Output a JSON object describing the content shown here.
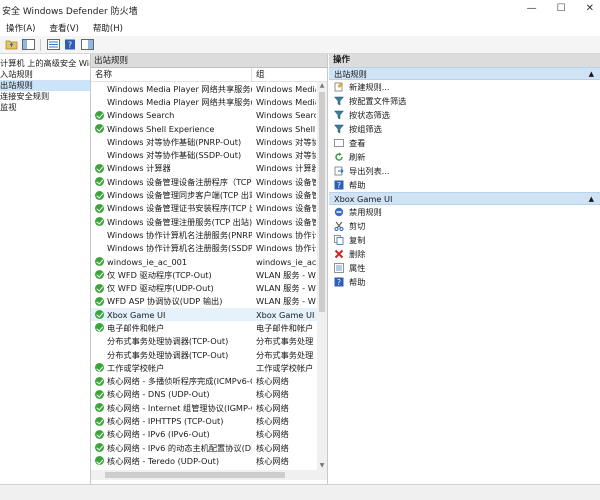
{
  "window": {
    "title": "安全 Windows Defender 防火墙"
  },
  "menu": {
    "items": [
      "操作(A)",
      "查看(V)",
      "帮助(H)"
    ]
  },
  "tree": {
    "items": [
      {
        "label": "计算机 上的高级安全 Windo",
        "selected": false
      },
      {
        "label": "入站规则",
        "selected": false
      },
      {
        "label": "出站规则",
        "selected": true
      },
      {
        "label": "连接安全规则",
        "selected": false
      },
      {
        "label": "监视",
        "selected": false
      }
    ]
  },
  "rules": {
    "pane_title": "出站规则",
    "columns": {
      "name": "名称",
      "group": "组"
    },
    "rows": [
      {
        "name": "Windows Media Player 网络共享服务(U...",
        "group": "Windows Media P",
        "enabled": false,
        "selected": false
      },
      {
        "name": "Windows Media Player 网络共享服务(U...",
        "group": "Windows Media P",
        "enabled": false,
        "selected": false
      },
      {
        "name": "Windows Search",
        "group": "Windows Search",
        "enabled": true,
        "selected": false
      },
      {
        "name": "Windows Shell Experience",
        "group": "Windows Shell Ex",
        "enabled": true,
        "selected": false
      },
      {
        "name": "Windows 对等协作基础(PNRP-Out)",
        "group": "Windows 对等协作",
        "enabled": false,
        "selected": false
      },
      {
        "name": "Windows 对等协作基础(SSDP-Out)",
        "group": "Windows 对等协作",
        "enabled": false,
        "selected": false
      },
      {
        "name": "Windows 计算器",
        "group": "Windows 计算器",
        "enabled": true,
        "selected": false
      },
      {
        "name": "Windows 设备管理设备注册程序（TCP ...",
        "group": "Windows 设备管",
        "enabled": true,
        "selected": false
      },
      {
        "name": "Windows 设备管理同步客户端(TCP 出站)",
        "group": "Windows 设备管",
        "enabled": true,
        "selected": false
      },
      {
        "name": "Windows 设备管理证书安装程序(TCP 出...",
        "group": "Windows 设备管",
        "enabled": true,
        "selected": false
      },
      {
        "name": "Windows 设备管理注册服务(TCP 出站)",
        "group": "Windows 设备管",
        "enabled": true,
        "selected": false
      },
      {
        "name": "Windows 协作计算机名注册服务(PNRP-...",
        "group": "Windows 协作计",
        "enabled": false,
        "selected": false
      },
      {
        "name": "Windows 协作计算机名注册服务(SSDP-...",
        "group": "Windows 协作计",
        "enabled": false,
        "selected": false
      },
      {
        "name": "windows_ie_ac_001",
        "group": "windows_ie_ac_0",
        "enabled": true,
        "selected": false
      },
      {
        "name": "仅 WFD 驱动程序(TCP-Out)",
        "group": "WLAN 服务 - WF",
        "enabled": true,
        "selected": false
      },
      {
        "name": "仅 WFD 驱动程序(UDP-Out)",
        "group": "WLAN 服务 - WF",
        "enabled": true,
        "selected": false
      },
      {
        "name": "WFD ASP 协调协议(UDP 输出)",
        "group": "WLAN 服务 - WF",
        "enabled": true,
        "selected": false
      },
      {
        "name": "Xbox Game UI",
        "group": "Xbox Game UI",
        "enabled": true,
        "selected": true
      },
      {
        "name": "电子邮件和帐户",
        "group": "电子邮件和帐户",
        "enabled": true,
        "selected": false
      },
      {
        "name": "分布式事务处理协调器(TCP-Out)",
        "group": "分布式事务处理",
        "enabled": false,
        "selected": false
      },
      {
        "name": "分布式事务处理协调器(TCP-Out)",
        "group": "分布式事务处理",
        "enabled": false,
        "selected": false
      },
      {
        "name": "工作或学校帐户",
        "group": "工作或学校帐户",
        "enabled": true,
        "selected": false
      },
      {
        "name": "核心网络 - 多播侦听程序完成(ICMPv6-O...",
        "group": "核心网络",
        "enabled": true,
        "selected": false
      },
      {
        "name": "核心网络 - DNS (UDP-Out)",
        "group": "核心网络",
        "enabled": true,
        "selected": false
      },
      {
        "name": "核心网络 - Internet 组管理协议(IGMP-O...",
        "group": "核心网络",
        "enabled": true,
        "selected": false
      },
      {
        "name": "核心网络 - IPHTTPS (TCP-Out)",
        "group": "核心网络",
        "enabled": true,
        "selected": false
      },
      {
        "name": "核心网络 - IPv6 (IPv6-Out)",
        "group": "核心网络",
        "enabled": true,
        "selected": false
      },
      {
        "name": "核心网络 - IPv6 的动态主机配置协议(DH...",
        "group": "核心网络",
        "enabled": true,
        "selected": false
      },
      {
        "name": "核心网络 - Teredo (UDP-Out)",
        "group": "核心网络",
        "enabled": true,
        "selected": false
      }
    ]
  },
  "actions": {
    "title": "操作",
    "sections": [
      {
        "label": "出站规则",
        "items": [
          {
            "label": "新建规则...",
            "icon": "new-rule-icon"
          },
          {
            "label": "按配置文件筛选",
            "icon": "filter-icon"
          },
          {
            "label": "按状态筛选",
            "icon": "filter-icon"
          },
          {
            "label": "按组筛选",
            "icon": "filter-icon"
          },
          {
            "label": "查看",
            "icon": "view-icon"
          },
          {
            "label": "刷新",
            "icon": "refresh-icon"
          },
          {
            "label": "导出列表...",
            "icon": "export-icon"
          },
          {
            "label": "帮助",
            "icon": "help-icon"
          }
        ]
      },
      {
        "label": "Xbox Game UI",
        "items": [
          {
            "label": "禁用规则",
            "icon": "disable-icon"
          },
          {
            "label": "剪切",
            "icon": "cut-icon"
          },
          {
            "label": "复制",
            "icon": "copy-icon"
          },
          {
            "label": "删除",
            "icon": "delete-icon"
          },
          {
            "label": "属性",
            "icon": "properties-icon"
          },
          {
            "label": "帮助",
            "icon": "help-icon"
          }
        ]
      }
    ]
  },
  "colors": {
    "enabled_green": "#3aa63a",
    "section_blue": "#cfe3f5",
    "selected": "#cce4f7",
    "delete_red": "#d42020"
  }
}
